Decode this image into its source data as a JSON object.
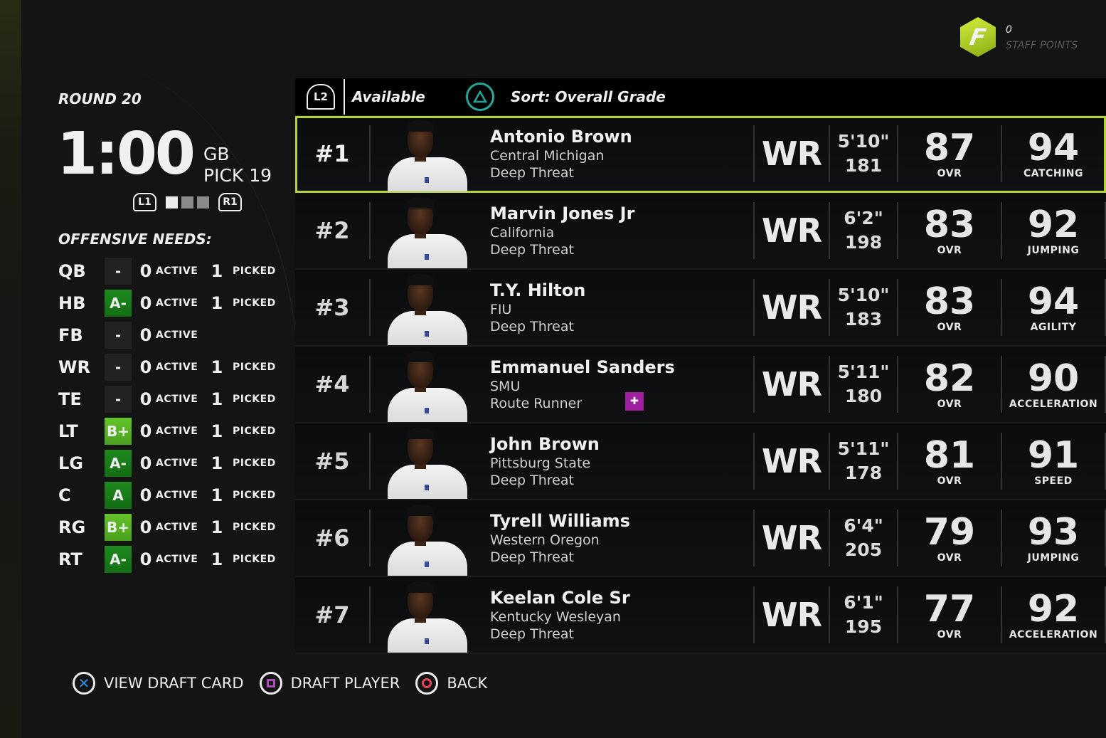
{
  "staff": {
    "value": "0",
    "label": "STAFF POINTS",
    "logo_letter": "F"
  },
  "draft": {
    "round": "ROUND 20",
    "clock": "1:00",
    "team": "GB",
    "pick": "PICK 19",
    "pager": {
      "left_button": "L1",
      "right_button": "R1",
      "pages": 3,
      "current_page": 1
    }
  },
  "needs": {
    "title": "OFFENSIVE NEEDS:",
    "active_label": "ACTIVE",
    "picked_label": "PICKED",
    "rows": [
      {
        "pos": "QB",
        "grade": "-",
        "grade_class": "none",
        "active": "0",
        "picked": "1"
      },
      {
        "pos": "HB",
        "grade": "A-",
        "grade_class": "gA",
        "active": "0",
        "picked": "1"
      },
      {
        "pos": "FB",
        "grade": "-",
        "grade_class": "none",
        "active": "0",
        "picked": null
      },
      {
        "pos": "WR",
        "grade": "-",
        "grade_class": "none",
        "active": "0",
        "picked": "1"
      },
      {
        "pos": "TE",
        "grade": "-",
        "grade_class": "none",
        "active": "0",
        "picked": "1"
      },
      {
        "pos": "LT",
        "grade": "B+",
        "grade_class": "gB",
        "active": "0",
        "picked": "1"
      },
      {
        "pos": "LG",
        "grade": "A-",
        "grade_class": "gA",
        "active": "0",
        "picked": "1"
      },
      {
        "pos": "C",
        "grade": "A",
        "grade_class": "gA",
        "active": "0",
        "picked": "1"
      },
      {
        "pos": "RG",
        "grade": "B+",
        "grade_class": "gB",
        "active": "0",
        "picked": "1"
      },
      {
        "pos": "RT",
        "grade": "A-",
        "grade_class": "gA",
        "active": "0",
        "picked": "1"
      }
    ]
  },
  "list_header": {
    "filter_button": "L2",
    "filter": "Available",
    "sort_button_icon": "triangle-button-icon",
    "sort": "Sort: Overall Grade"
  },
  "players": [
    {
      "rank": "#1",
      "name": "Antonio Brown",
      "school": "Central Michigan",
      "archetype": "Deep Threat",
      "pos": "WR",
      "height": "5'10\"",
      "weight": "181",
      "ovr": "87",
      "ovr_label": "OVR",
      "top_stat": "94",
      "top_stat_label": "CATCHING",
      "selected": true,
      "ability_icon": false
    },
    {
      "rank": "#2",
      "name": "Marvin Jones Jr",
      "school": "California",
      "archetype": "Deep Threat",
      "pos": "WR",
      "height": "6'2\"",
      "weight": "198",
      "ovr": "83",
      "ovr_label": "OVR",
      "top_stat": "92",
      "top_stat_label": "JUMPING",
      "selected": false,
      "ability_icon": false
    },
    {
      "rank": "#3",
      "name": "T.Y. Hilton",
      "school": "FIU",
      "archetype": "Deep Threat",
      "pos": "WR",
      "height": "5'10\"",
      "weight": "183",
      "ovr": "83",
      "ovr_label": "OVR",
      "top_stat": "94",
      "top_stat_label": "AGILITY",
      "selected": false,
      "ability_icon": false
    },
    {
      "rank": "#4",
      "name": "Emmanuel Sanders",
      "school": "SMU",
      "archetype": "Route Runner",
      "pos": "WR",
      "height": "5'11\"",
      "weight": "180",
      "ovr": "82",
      "ovr_label": "OVR",
      "top_stat": "90",
      "top_stat_label": "ACCELERATION",
      "selected": false,
      "ability_icon": true
    },
    {
      "rank": "#5",
      "name": "John Brown",
      "school": "Pittsburg State",
      "archetype": "Deep Threat",
      "pos": "WR",
      "height": "5'11\"",
      "weight": "178",
      "ovr": "81",
      "ovr_label": "OVR",
      "top_stat": "91",
      "top_stat_label": "SPEED",
      "selected": false,
      "ability_icon": false
    },
    {
      "rank": "#6",
      "name": "Tyrell Williams",
      "school": "Western Oregon",
      "archetype": "Deep Threat",
      "pos": "WR",
      "height": "6'4\"",
      "weight": "205",
      "ovr": "79",
      "ovr_label": "OVR",
      "top_stat": "93",
      "top_stat_label": "JUMPING",
      "selected": false,
      "ability_icon": false
    },
    {
      "rank": "#7",
      "name": "Keelan Cole Sr",
      "school": "Kentucky Wesleyan",
      "archetype": "Deep Threat",
      "pos": "WR",
      "height": "6'1\"",
      "weight": "195",
      "ovr": "77",
      "ovr_label": "OVR",
      "top_stat": "92",
      "top_stat_label": "ACCELERATION",
      "selected": false,
      "ability_icon": false
    }
  ],
  "footer": {
    "view_card": "VIEW DRAFT CARD",
    "draft_player": "DRAFT PLAYER",
    "back": "BACK"
  },
  "colors": {
    "selection": "#b4d334",
    "grade_a": "#1e8a1e",
    "grade_b": "#64c42a",
    "cross": "#2d8de0",
    "square": "#b04ac0",
    "circle": "#e04858",
    "triangle": "#24a89a",
    "ability": "#a01fa0"
  }
}
